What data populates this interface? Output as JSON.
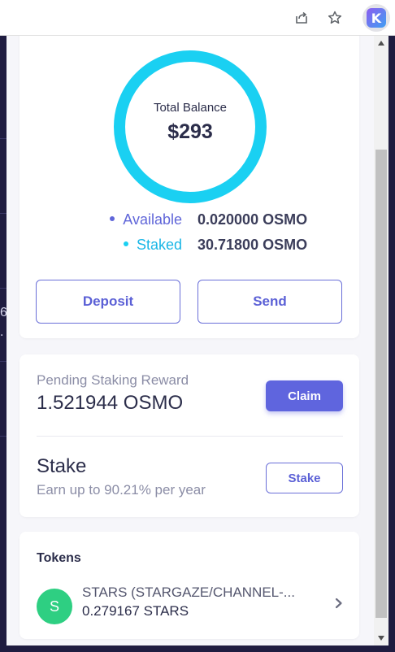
{
  "balance": {
    "total_label": "Total Balance",
    "total_value": "$293",
    "available_label": "Available",
    "available_value": "0.020000 OSMO",
    "staked_label": "Staked",
    "staked_value": "30.71800 OSMO",
    "deposit_label": "Deposit",
    "send_label": "Send"
  },
  "reward": {
    "label": "Pending Staking Reward",
    "value": "1.521944 OSMO",
    "claim_label": "Claim"
  },
  "stake": {
    "title": "Stake",
    "subtitle": "Earn up to 90.21% per year",
    "button_label": "Stake"
  },
  "tokens": {
    "title": "Tokens",
    "items": [
      {
        "avatar_letter": "S",
        "name": "STARS (STARGAZE/CHANNEL-...",
        "amount": "0.279167 STARS"
      }
    ]
  },
  "browser": {
    "extension_letter": "K"
  },
  "background_fragments": [
    "6",
    "."
  ],
  "colors": {
    "accent": "#5f65de",
    "ring": "#1ad0f2",
    "available_dot": "#6066d9",
    "staked_dot": "#1ad0f2",
    "token_avatar": "#2ecf82"
  },
  "icons": [
    "share-icon",
    "star-icon",
    "extension-icon",
    "chevron-right-icon",
    "scroll-up-icon",
    "scroll-down-icon"
  ]
}
